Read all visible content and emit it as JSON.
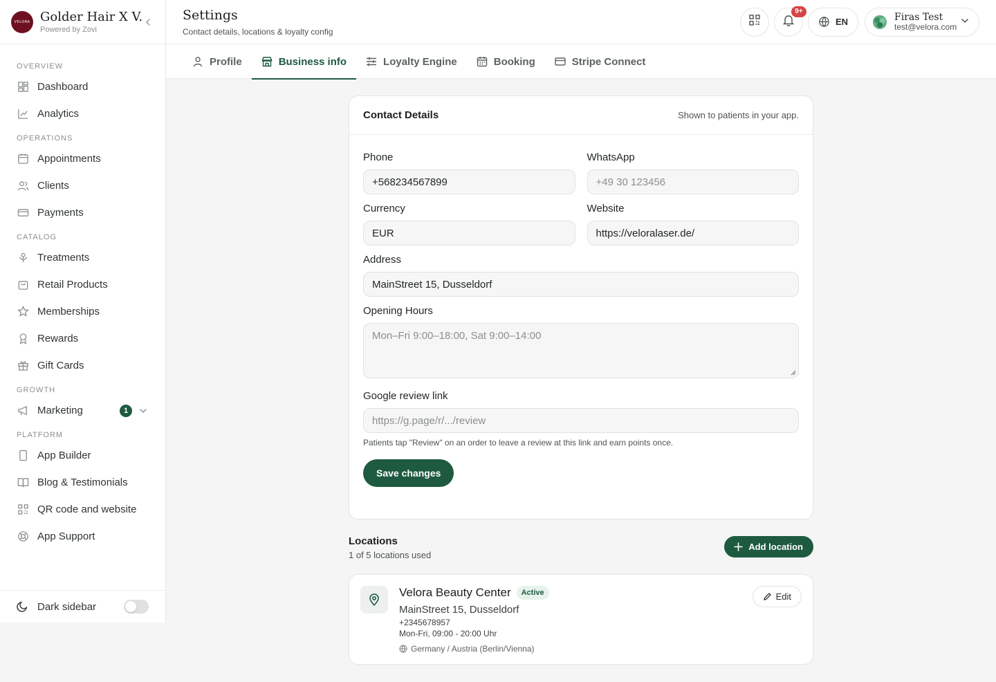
{
  "brand": {
    "name": "Golder Hair X V...",
    "powered_by": "Powered by Zovi",
    "logo_text": "VELORA",
    "logo_color": "#6e1020"
  },
  "sidebar": {
    "sections": [
      {
        "title": "OVERVIEW",
        "items": [
          {
            "label": "Dashboard",
            "icon": "dashboard-icon"
          },
          {
            "label": "Analytics",
            "icon": "chart-line-icon"
          }
        ]
      },
      {
        "title": "OPERATIONS",
        "items": [
          {
            "label": "Appointments",
            "icon": "calendar-icon"
          },
          {
            "label": "Clients",
            "icon": "users-icon"
          },
          {
            "label": "Payments",
            "icon": "credit-card-icon"
          }
        ]
      },
      {
        "title": "CATALOG",
        "items": [
          {
            "label": "Treatments",
            "icon": "flower-icon"
          },
          {
            "label": "Retail Products",
            "icon": "shopping-bag-icon"
          },
          {
            "label": "Memberships",
            "icon": "star-icon"
          },
          {
            "label": "Rewards",
            "icon": "award-icon"
          },
          {
            "label": "Gift Cards",
            "icon": "gift-icon"
          }
        ]
      },
      {
        "title": "GROWTH",
        "items": [
          {
            "label": "Marketing",
            "icon": "megaphone-icon",
            "badge": "1"
          }
        ]
      },
      {
        "title": "PLATFORM",
        "items": [
          {
            "label": "App Builder",
            "icon": "smartphone-icon"
          },
          {
            "label": "Blog & Testimonials",
            "icon": "book-icon"
          },
          {
            "label": "QR code and website",
            "icon": "qr-code-icon"
          },
          {
            "label": "App Support",
            "icon": "life-buoy-icon"
          }
        ]
      }
    ],
    "footer": {
      "label": "Dark sidebar",
      "toggle_on": false
    }
  },
  "header": {
    "title": "Settings",
    "subtitle": "Contact details, locations & loyalty config",
    "notifications_badge": "9+",
    "language": "EN",
    "user": {
      "name": "Firas Test",
      "email": "test@velora.com"
    }
  },
  "tabs": [
    {
      "label": "Profile",
      "icon": "user-icon",
      "active": false
    },
    {
      "label": "Business info",
      "icon": "store-icon",
      "active": true
    },
    {
      "label": "Loyalty Engine",
      "icon": "sliders-icon",
      "active": false
    },
    {
      "label": "Booking",
      "icon": "calendar-icon",
      "active": false
    },
    {
      "label": "Stripe Connect",
      "icon": "credit-card-icon",
      "active": false
    }
  ],
  "contact": {
    "title": "Contact Details",
    "note": "Shown to patients in your app.",
    "phone": {
      "label": "Phone",
      "value": "+568234567899"
    },
    "whatsapp": {
      "label": "WhatsApp",
      "value": "",
      "placeholder": "+49 30 123456"
    },
    "currency": {
      "label": "Currency",
      "value": "EUR"
    },
    "website": {
      "label": "Website",
      "value": "https://veloralaser.de/"
    },
    "address": {
      "label": "Address",
      "value": "MainStreet 15, Dusseldorf"
    },
    "opening_hours": {
      "label": "Opening Hours",
      "value": "",
      "placeholder": "Mon–Fri 9:00–18:00, Sat 9:00–14:00"
    },
    "google_review": {
      "label": "Google review link",
      "value": "",
      "placeholder": "https://g.page/r/.../review",
      "help": "Patients tap \"Review\" on an order to leave a review at this link and earn points once."
    },
    "save_label": "Save changes"
  },
  "locations": {
    "title": "Locations",
    "usage": "1 of 5 locations used",
    "add_label": "Add location",
    "items": [
      {
        "name": "Velora Beauty Center",
        "status": "Active",
        "address": "MainStreet 15, Dusseldorf",
        "phone": "+2345678957",
        "hours": "Mon-Fri, 09:00 - 20:00 Uhr",
        "timezone": "Germany / Austria (Berlin/Vienna)",
        "edit_label": "Edit"
      }
    ]
  },
  "colors": {
    "accent": "#1e5a40",
    "notification": "#d64545",
    "active_badge_bg": "#e6f2ea"
  }
}
